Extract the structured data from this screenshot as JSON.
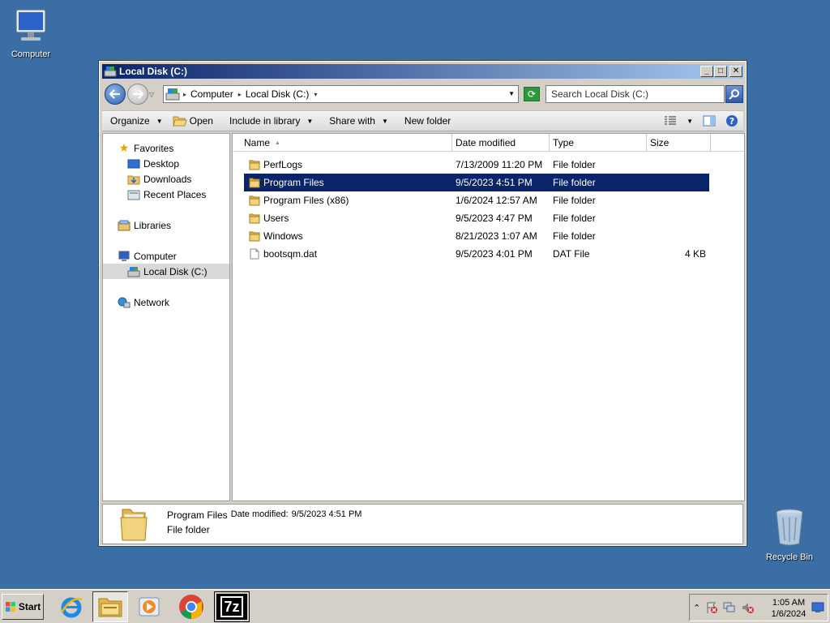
{
  "desktop": {
    "icons": [
      {
        "label": "Computer",
        "icon": "computer-icon"
      },
      {
        "label": "Recycle Bin",
        "icon": "recycle-bin-icon"
      }
    ],
    "background_color": "#3a6ea5"
  },
  "window": {
    "title": "Local Disk (C:)",
    "controls": [
      "minimize",
      "maximize",
      "close"
    ],
    "address": {
      "crumbs": [
        "Computer",
        "Local Disk (C:)"
      ]
    },
    "search": {
      "placeholder": "Search Local Disk (C:)"
    },
    "toolbar": {
      "organize": "Organize",
      "open": "Open",
      "include": "Include in library",
      "share": "Share with",
      "new_folder": "New folder"
    },
    "nav": {
      "favorites": "Favorites",
      "desktop": "Desktop",
      "downloads": "Downloads",
      "recent": "Recent Places",
      "libraries": "Libraries",
      "computer": "Computer",
      "local_disk": "Local Disk (C:)",
      "network": "Network"
    },
    "columns": {
      "name": "Name",
      "date": "Date modified",
      "type": "Type",
      "size": "Size"
    },
    "files": [
      {
        "name": "PerfLogs",
        "date": "7/13/2009 11:20 PM",
        "type": "File folder",
        "size": "",
        "kind": "folder"
      },
      {
        "name": "Program Files",
        "date": "9/5/2023 4:51 PM",
        "type": "File folder",
        "size": "",
        "kind": "folder",
        "selected": true
      },
      {
        "name": "Program Files (x86)",
        "date": "1/6/2024 12:57 AM",
        "type": "File folder",
        "size": "",
        "kind": "folder"
      },
      {
        "name": "Users",
        "date": "9/5/2023 4:47 PM",
        "type": "File folder",
        "size": "",
        "kind": "folder"
      },
      {
        "name": "Windows",
        "date": "8/21/2023 1:07 AM",
        "type": "File folder",
        "size": "",
        "kind": "folder"
      },
      {
        "name": "bootsqm.dat",
        "date": "9/5/2023 4:01 PM",
        "type": "DAT File",
        "size": "4 KB",
        "kind": "file"
      }
    ],
    "details": {
      "name": "Program Files",
      "meta_label": "Date modified:",
      "meta_value": "9/5/2023 4:51 PM",
      "type": "File folder"
    }
  },
  "taskbar": {
    "start": "Start",
    "apps": [
      "internet-explorer-icon",
      "windows-explorer-icon",
      "media-player-icon",
      "chrome-icon",
      "7zip-icon"
    ],
    "seven_zip_label": "7z",
    "clock": {
      "time": "1:05 AM",
      "date": "1/6/2024"
    }
  },
  "colors": {
    "selection": "#0a246a",
    "titlebar_start": "#0a246a",
    "titlebar_end": "#a6caf0"
  }
}
